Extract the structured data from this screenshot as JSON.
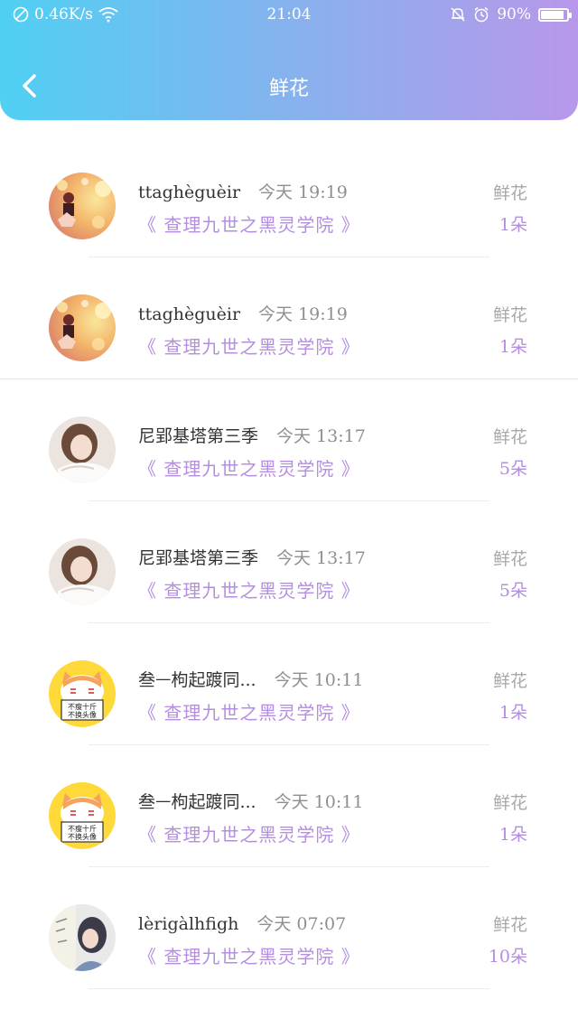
{
  "status_bar": {
    "speed": "0.46K/s",
    "time": "21:04",
    "battery": "90%",
    "battery_level": 0.9
  },
  "header": {
    "title": "鲜花"
  },
  "rows": [
    {
      "user": "ttaghèguèir",
      "time": "今天 19:19",
      "work": "《 查理九世之黑灵学院 》",
      "gift_type": "鲜花",
      "count": "1朵",
      "avatar_icon": "anime-girl-bokeh-avatar-icon"
    },
    {
      "user": "ttaghèguèir",
      "time": "今天 19:19",
      "work": "《 查理九世之黑灵学院 》",
      "gift_type": "鲜花",
      "count": "1朵",
      "avatar_icon": "anime-girl-bokeh-avatar-icon"
    },
    {
      "user": "尼郢基塔第三季",
      "time": "今天 13:17",
      "work": "《 查理九世之黑灵学院 》",
      "gift_type": "鲜花",
      "count": "5朵",
      "avatar_icon": "girl-photo-avatar-icon"
    },
    {
      "user": "尼郢基塔第三季",
      "time": "今天 13:17",
      "work": "《 查理九世之黑灵学院 》",
      "gift_type": "鲜花",
      "count": "5朵",
      "avatar_icon": "girl-photo-avatar-icon"
    },
    {
      "user": "叁ᅳ枸起踱同...",
      "time": "今天 10:11",
      "work": "《 查理九世之黑灵学院 》",
      "gift_type": "鲜花",
      "count": "1朵",
      "avatar_icon": "cartoon-cat-sign-avatar-icon",
      "avatar_text": [
        "不瘦十斤",
        "不换头像"
      ]
    },
    {
      "user": "叁ᅳ枸起踱同...",
      "time": "今天 10:11",
      "work": "《 查理九世之黑灵学院 》",
      "gift_type": "鲜花",
      "count": "1朵",
      "avatar_icon": "cartoon-cat-sign-avatar-icon",
      "avatar_text": [
        "不瘦十斤",
        "不换头像"
      ]
    },
    {
      "user": "lèrigàlhfigh",
      "time": "今天 07:07",
      "work": "《 查理九世之黑灵学院 》",
      "gift_type": "鲜花",
      "count": "10朵",
      "avatar_icon": "girl-illustration-avatar-icon"
    }
  ],
  "colors": {
    "header_gradient": [
      "#4fd0f3",
      "#86b2ee",
      "#b897ea"
    ],
    "accent_purple": "#b48ee0"
  }
}
